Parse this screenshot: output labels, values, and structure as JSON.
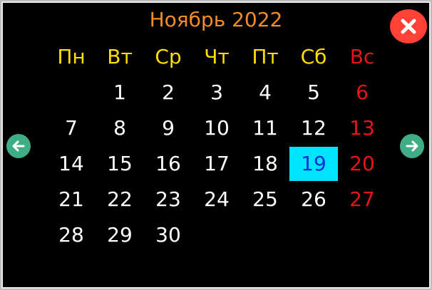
{
  "title": "Ноябрь 2022",
  "weekdays": [
    "Пн",
    "Вт",
    "Ср",
    "Чт",
    "Пт",
    "Сб",
    "Вс"
  ],
  "first_weekday_index": 1,
  "days_in_month": 30,
  "today": 19,
  "colors": {
    "title": "#f28c28",
    "weekday": "#ffdf00",
    "sunday": "#e81416",
    "day": "#ffffff",
    "today_bg": "#00e5ff",
    "today_text": "#0b2fd6",
    "close": "#ff4136",
    "nav": "#3fae86"
  },
  "icons": {
    "close": "close-icon",
    "prev": "arrow-left-icon",
    "next": "arrow-right-icon"
  }
}
